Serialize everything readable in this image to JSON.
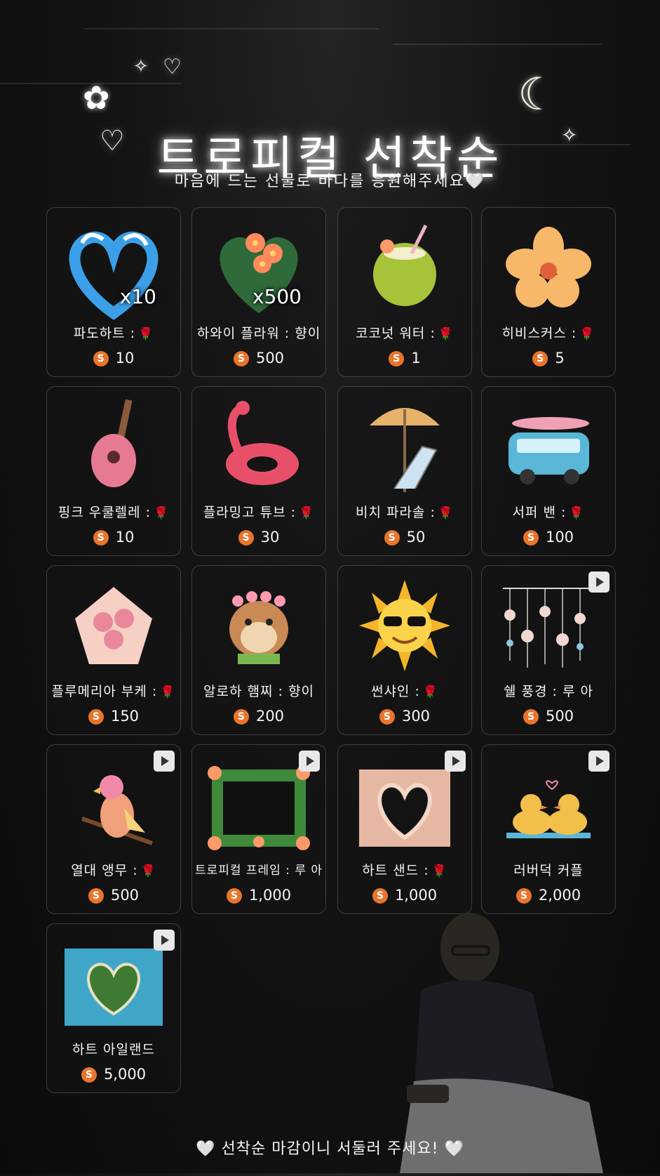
{
  "header": {
    "title": "트로피컬 선착순",
    "subtitle": "마음에 드는 선물로 바다를 응원해주세요",
    "subtitle_heart": "🤍"
  },
  "coin_icon_label": "S",
  "items": [
    {
      "name": "파도하트 :",
      "badge": "🌹",
      "price": "10",
      "multiplier": "x10",
      "video": false,
      "icon": "wave-heart-icon"
    },
    {
      "name": "하와이 플라워 : 향이",
      "badge": "",
      "price": "500",
      "multiplier": "x500",
      "video": false,
      "icon": "hawaii-flower-icon"
    },
    {
      "name": "코코넛 워터 :",
      "badge": "🌹",
      "price": "1",
      "multiplier": "",
      "video": false,
      "icon": "coconut-icon"
    },
    {
      "name": "히비스커스 :",
      "badge": "🌹",
      "price": "5",
      "multiplier": "",
      "video": false,
      "icon": "hibiscus-icon"
    },
    {
      "name": "핑크 우쿨렐레 :",
      "badge": "🌹",
      "price": "10",
      "multiplier": "",
      "video": false,
      "icon": "ukulele-icon"
    },
    {
      "name": "플라밍고 튜브 :",
      "badge": "🌹",
      "price": "30",
      "multiplier": "",
      "video": false,
      "icon": "flamingo-tube-icon"
    },
    {
      "name": "비치 파라솔 :",
      "badge": "🌹",
      "price": "50",
      "multiplier": "",
      "video": false,
      "icon": "parasol-icon"
    },
    {
      "name": "서퍼 밴 :",
      "badge": "🌹",
      "price": "100",
      "multiplier": "",
      "video": false,
      "icon": "surfer-van-icon"
    },
    {
      "name": "플루메리아 부케 :",
      "badge": "🌹",
      "price": "150",
      "multiplier": "",
      "video": false,
      "icon": "bouquet-icon"
    },
    {
      "name": "알로하 햄찌 : 향이",
      "badge": "",
      "price": "200",
      "multiplier": "",
      "video": false,
      "icon": "hamster-icon"
    },
    {
      "name": "썬샤인 :",
      "badge": "🌹",
      "price": "300",
      "multiplier": "",
      "video": false,
      "icon": "sun-icon"
    },
    {
      "name": "쉘 풍경 : 루 아",
      "badge": "",
      "price": "500",
      "multiplier": "",
      "video": true,
      "icon": "shell-chime-icon"
    },
    {
      "name": "열대 앵무 :",
      "badge": "🌹",
      "price": "500",
      "multiplier": "",
      "video": true,
      "icon": "parrot-icon"
    },
    {
      "name": "트로피컬 프레임 : 루 아",
      "badge": "",
      "price": "1,000",
      "multiplier": "",
      "video": true,
      "icon": "tropical-frame-icon"
    },
    {
      "name": "하트 샌드 :",
      "badge": "🌹",
      "price": "1,000",
      "multiplier": "",
      "video": true,
      "icon": "heart-sand-icon"
    },
    {
      "name": "러버덕 커플",
      "badge": "",
      "price": "2,000",
      "multiplier": "",
      "video": true,
      "icon": "rubber-duck-icon"
    },
    {
      "name": "하트 아일랜드",
      "badge": "",
      "price": "5,000",
      "multiplier": "",
      "video": true,
      "icon": "heart-island-icon"
    }
  ],
  "footer": {
    "text": "선착순 마감이니 서둘러 주세요!",
    "heart": "🤍"
  }
}
